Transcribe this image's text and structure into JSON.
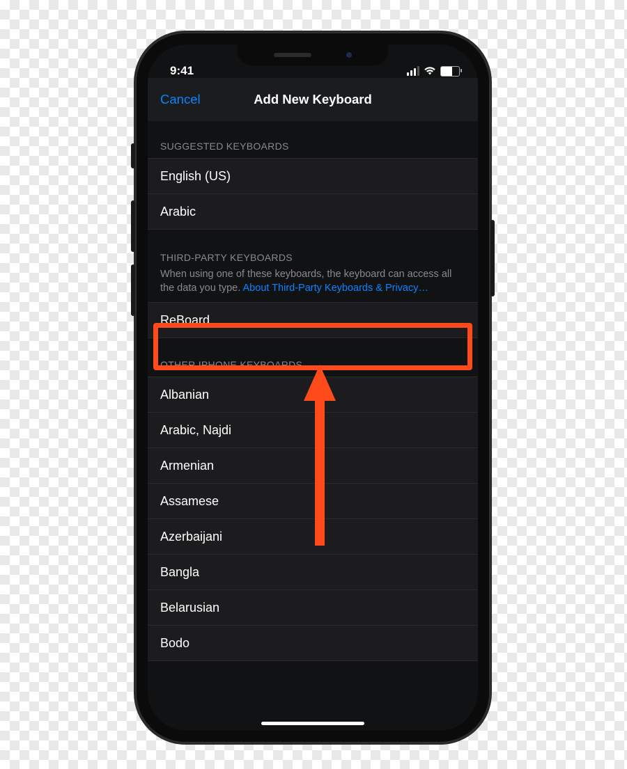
{
  "status": {
    "time": "9:41"
  },
  "navbar": {
    "cancel": "Cancel",
    "title": "Add New Keyboard"
  },
  "sections": {
    "suggested": {
      "header": "SUGGESTED KEYBOARDS",
      "items": [
        "English (US)",
        "Arabic"
      ]
    },
    "thirdparty": {
      "header": "THIRD-PARTY KEYBOARDS",
      "note_prefix": "When using one of these keyboards, the keyboard can access all the data you type. ",
      "note_link": "About Third-Party Keyboards & Privacy…",
      "items": [
        "ReBoard"
      ]
    },
    "other": {
      "header": "OTHER IPHONE KEYBOARDS",
      "items": [
        "Albanian",
        "Arabic, Najdi",
        "Armenian",
        "Assamese",
        "Azerbaijani",
        "Bangla",
        "Belarusian",
        "Bodo"
      ]
    }
  },
  "colors": {
    "accent": "#0a84ff",
    "highlight": "#ff4a1c"
  }
}
